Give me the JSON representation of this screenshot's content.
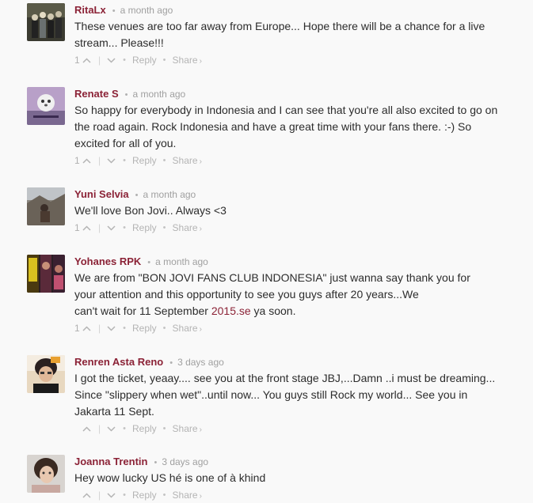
{
  "comments": [
    {
      "author": "RitaLx",
      "time": "a month ago",
      "lines": [
        "These venues are too far away from Europe... Hope there will be a chance for a live",
        "stream... Please!!!"
      ],
      "votes": "1",
      "reply": "Reply",
      "share": "Share"
    },
    {
      "author": "Renate S",
      "time": "a month ago",
      "lines": [
        "So happy for everybody in Indonesia and I can see that you're all also excited to go on",
        "the road again. Rock Indonesia and have a great time with your fans there. :-) So",
        "excited for all of you."
      ],
      "votes": "1",
      "reply": "Reply",
      "share": "Share"
    },
    {
      "author": "Yuni Selvia",
      "time": "a month ago",
      "lines": [
        "We'll love Bon Jovi.. Always <3"
      ],
      "votes": "1",
      "reply": "Reply",
      "share": "Share"
    },
    {
      "author": "Yohanes RPK",
      "time": "a month ago",
      "lines": [
        "We are from \"BON JOVI FANS CLUB INDONESIA\" just wanna say thank you for",
        "your attention and this opportunity to see you guys after 20 years...We"
      ],
      "line3_before": "can't wait for 11 September ",
      "line3_link": "2015.se",
      "line3_after": " ya soon.",
      "votes": "1",
      "reply": "Reply",
      "share": "Share"
    },
    {
      "author": "Renren Asta Reno",
      "time": "3 days ago",
      "lines": [
        "I got the ticket, yeaay.... see you at the front stage JBJ,...Damn ..i must be dreaming...",
        "Since \"slippery when wet\"..until now... You guys still Rock my world... See you in",
        "Jakarta 11 Sept."
      ],
      "votes": "",
      "reply": "Reply",
      "share": "Share"
    },
    {
      "author": "Joanna Trentin",
      "time": "3 days ago",
      "lines": [
        "Hey wow lucky US hé is one of à khind"
      ],
      "votes": "",
      "reply": "Reply",
      "share": "Share"
    }
  ],
  "ui": {
    "bullet": "•",
    "arrow": "›"
  },
  "icons": {
    "upvote": "chevron-up-icon",
    "downvote": "chevron-down-icon"
  },
  "colors": {
    "author": "#8b2236",
    "muted": "#b4b4b4",
    "text": "#2c2c2c",
    "background": "#f9f9f9"
  }
}
